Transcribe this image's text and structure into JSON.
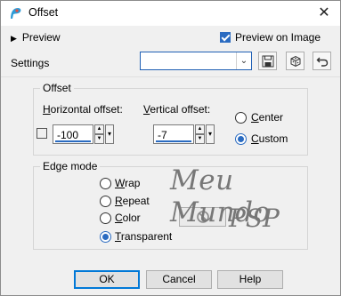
{
  "window": {
    "title": "Offset",
    "close_glyph": "✕"
  },
  "preview": {
    "label": "Preview",
    "preview_on_image_label": "Preview on Image",
    "preview_on_image_checked": true
  },
  "settings": {
    "label": "Settings",
    "value": ""
  },
  "offset": {
    "group_label": "Offset",
    "horizontal_label": "Horizontal offset:",
    "horizontal_value": "-100",
    "vertical_label": "Vertical offset:",
    "vertical_value": "-7",
    "center_label": "Center",
    "custom_label": "Custom",
    "selected": "custom",
    "link_checked": false
  },
  "edge_mode": {
    "group_label": "Edge mode",
    "options": [
      "Wrap",
      "Repeat",
      "Color",
      "Transparent"
    ],
    "selected": "Transparent"
  },
  "watermark": {
    "line1": "Meu Mundo",
    "line2": "PSP"
  },
  "buttons": {
    "ok": "OK",
    "cancel": "Cancel",
    "help": "Help"
  },
  "colors": {
    "accent": "#2a6bc1",
    "default_button_border": "#0078d7"
  }
}
